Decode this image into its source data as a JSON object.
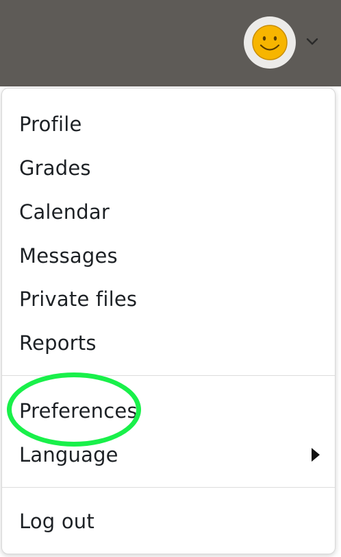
{
  "header": {
    "avatar_icon": "smiley-face-icon",
    "caret_icon": "chevron-down-icon",
    "bar_color": "#5e5b57"
  },
  "user_menu": {
    "items": [
      {
        "label": "Profile"
      },
      {
        "label": "Grades"
      },
      {
        "label": "Calendar"
      },
      {
        "label": "Messages"
      },
      {
        "label": "Private files"
      },
      {
        "label": "Reports"
      },
      {
        "label": "Preferences"
      },
      {
        "label": "Language",
        "submenu_icon": "caret-right-icon"
      },
      {
        "label": "Log out"
      }
    ],
    "highlight": {
      "target": "Preferences",
      "color": "#19f04a"
    }
  }
}
